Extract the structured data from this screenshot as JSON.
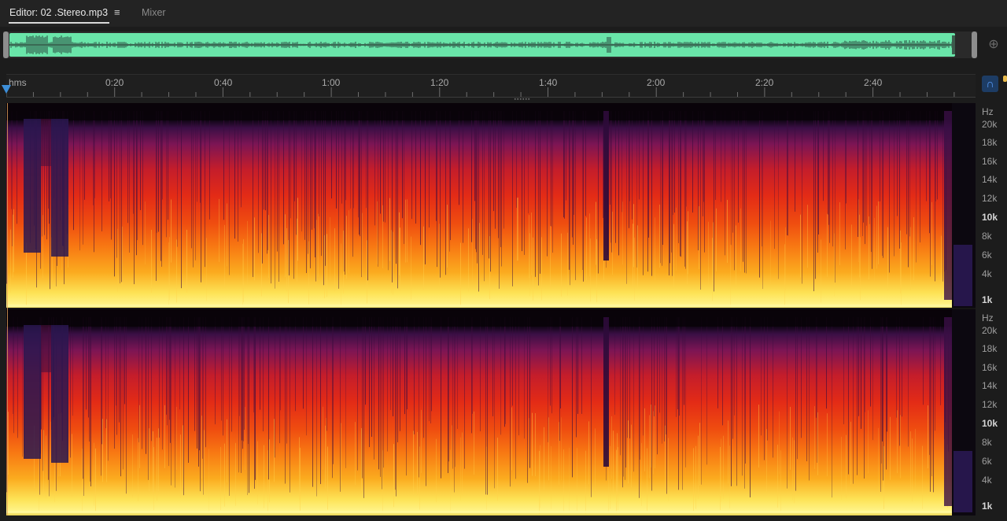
{
  "tabs": {
    "editor_label": "Editor: 02 .Stereo.mp3",
    "menu_icon": "hamburger-menu-icon",
    "mixer_label": "Mixer"
  },
  "overview": {
    "zoom_icon": "zoom-to-selection-icon",
    "waveform_color": "#69e5a9"
  },
  "ruler": {
    "unit_label": "hms",
    "labels": [
      "0:20",
      "0:40",
      "1:00",
      "1:20",
      "1:40",
      "2:00",
      "2:20",
      "2:40"
    ],
    "snap_icon": "snap-magnet-icon"
  },
  "spectrogram": {
    "channel_1": {
      "unit": "Hz",
      "labels": [
        "20k",
        "18k",
        "16k",
        "14k",
        "12k",
        "10k",
        "8k",
        "6k",
        "4k",
        "1k"
      ]
    },
    "channel_2": {
      "unit": "Hz",
      "labels": [
        "20k",
        "18k",
        "16k",
        "14k",
        "12k",
        "10k",
        "8k",
        "6k",
        "4k",
        "1k"
      ]
    },
    "colors": {
      "low": "#3a0f45",
      "mid": "#e32b16",
      "high": "#fde255"
    }
  }
}
